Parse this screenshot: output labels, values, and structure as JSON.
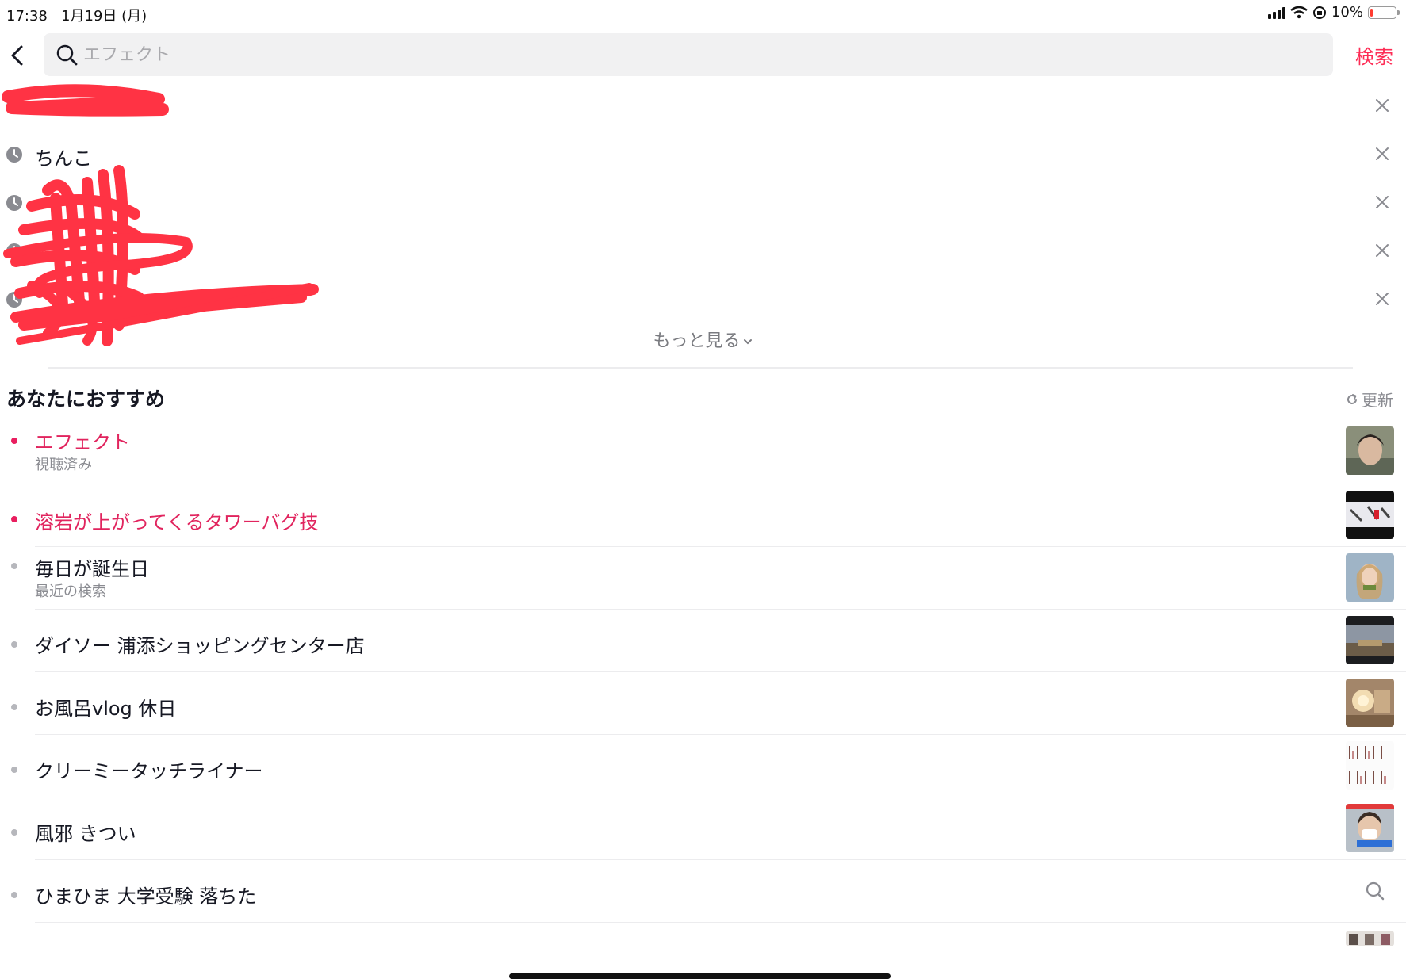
{
  "status_bar": {
    "time": "17:38",
    "date": "1月19日 (月)",
    "battery": "10%",
    "battery_level": 0.1
  },
  "search": {
    "placeholder": "エフェクト",
    "value": "",
    "button": "検索",
    "icon": "search-icon"
  },
  "history": {
    "items": [
      {
        "label": "",
        "redacted": true
      },
      {
        "label": "ちんこ",
        "redacted": false
      },
      {
        "label": "",
        "redacted": true
      },
      {
        "label": "",
        "redacted": true
      },
      {
        "label": "",
        "redacted": true
      }
    ],
    "more": "もっと見る"
  },
  "recommend": {
    "title": "あなたにおすすめ",
    "refresh": "更新",
    "items": [
      {
        "title": "エフェクト",
        "subtitle": "視聴済み",
        "highlight": true
      },
      {
        "title": "溶岩が上がってくるタワーバグ技",
        "subtitle": "",
        "highlight": true
      },
      {
        "title": "毎日が誕生日",
        "subtitle": "最近の検索",
        "highlight": false
      },
      {
        "title": "ダイソー 浦添ショッピングセンター店",
        "subtitle": "",
        "highlight": false
      },
      {
        "title": "お風呂vlog 休日",
        "subtitle": "",
        "highlight": false
      },
      {
        "title": "クリーミータッチライナー",
        "subtitle": "",
        "highlight": false
      },
      {
        "title": "風邪 きつい",
        "subtitle": "",
        "highlight": false
      },
      {
        "title": "ひまひま 大学受験 落ちた",
        "subtitle": "",
        "highlight": false
      }
    ]
  },
  "colors": {
    "accent": "#fe2c55",
    "highlight_text": "#e1245e",
    "redaction": "#ff3344"
  }
}
